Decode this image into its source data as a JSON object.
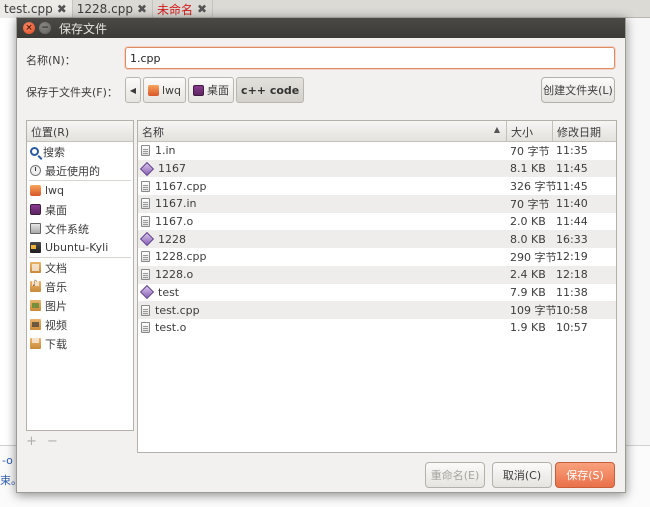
{
  "background": {
    "tabs": [
      {
        "label": "test.cpp",
        "close": "✖",
        "active": true,
        "red": false
      },
      {
        "label": "1228.cpp",
        "close": "✖",
        "active": false,
        "red": false
      },
      {
        "label": "未命名",
        "close": "✖",
        "active": false,
        "red": true
      }
    ],
    "console_line1": "-o",
    "console_line2": "束。"
  },
  "dialog": {
    "title": "保存文件",
    "name_label": "名称(N)：",
    "name_value": "1.cpp",
    "folder_label": "保存于文件夹(F)：",
    "path": [
      {
        "label": "lwq",
        "icon": "home-folder-icon"
      },
      {
        "label": "桌面",
        "icon": "desktop-folder-icon"
      },
      {
        "label": "c++ code",
        "icon": ""
      }
    ],
    "create_folder_label": "创建文件夹(L)",
    "places_header": "位置(R)",
    "places": [
      {
        "group": 1,
        "label": "搜索",
        "icon": "search-icon"
      },
      {
        "group": 1,
        "label": "最近使用的",
        "icon": "recent-icon"
      },
      {
        "group": 2,
        "label": "lwq",
        "icon": "home-folder-icon"
      },
      {
        "group": 2,
        "label": "桌面",
        "icon": "desktop-folder-icon"
      },
      {
        "group": 2,
        "label": "文件系统",
        "icon": "filesystem-icon"
      },
      {
        "group": 2,
        "label": "Ubuntu-Kyli",
        "icon": "drive-icon"
      },
      {
        "group": 3,
        "label": "文档",
        "icon": "documents-folder-icon"
      },
      {
        "group": 3,
        "label": "音乐",
        "icon": "music-folder-icon"
      },
      {
        "group": 3,
        "label": "图片",
        "icon": "pictures-folder-icon"
      },
      {
        "group": 3,
        "label": "视频",
        "icon": "videos-folder-icon"
      },
      {
        "group": 3,
        "label": "下载",
        "icon": "downloads-folder-icon"
      }
    ],
    "places_add": "+",
    "places_remove": "−",
    "columns": {
      "name": "名称",
      "size": "大小",
      "date": "修改日期"
    },
    "files": [
      {
        "name": "1.in",
        "size": "70 字节",
        "date": "11:35",
        "type": "text"
      },
      {
        "name": "1167",
        "size": "8.1 KB",
        "date": "11:45",
        "type": "exec"
      },
      {
        "name": "1167.cpp",
        "size": "326 字节",
        "date": "11:45",
        "type": "text"
      },
      {
        "name": "1167.in",
        "size": "70 字节",
        "date": "11:40",
        "type": "text"
      },
      {
        "name": "1167.o",
        "size": "2.0 KB",
        "date": "11:44",
        "type": "text"
      },
      {
        "name": "1228",
        "size": "8.0 KB",
        "date": "16:33",
        "type": "exec"
      },
      {
        "name": "1228.cpp",
        "size": "290 字节",
        "date": "12:19",
        "type": "text"
      },
      {
        "name": "1228.o",
        "size": "2.4 KB",
        "date": "12:18",
        "type": "text"
      },
      {
        "name": "test",
        "size": "7.9 KB",
        "date": "11:38",
        "type": "exec"
      },
      {
        "name": "test.cpp",
        "size": "109 字节",
        "date": "10:58",
        "type": "text"
      },
      {
        "name": "test.o",
        "size": "1.9 KB",
        "date": "10:57",
        "type": "text"
      }
    ],
    "rename_label": "重命名(E)",
    "cancel_label": "取消(C)",
    "save_label": "保存(S)"
  }
}
